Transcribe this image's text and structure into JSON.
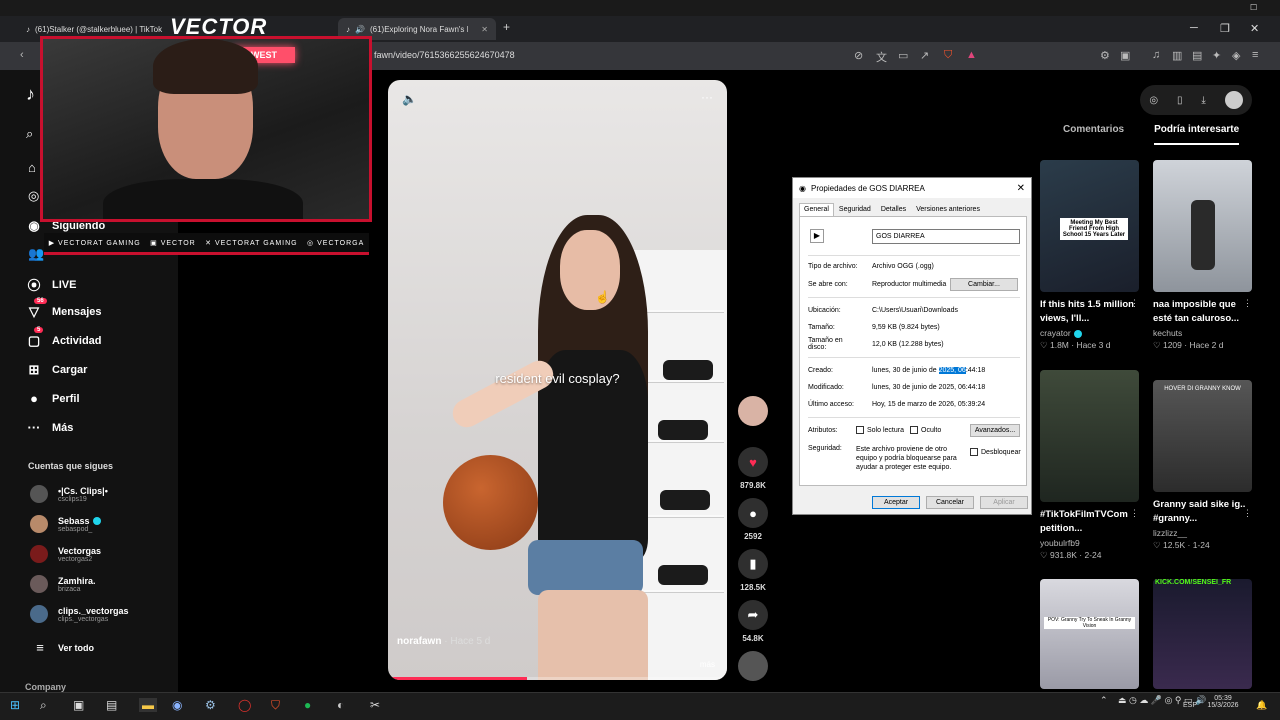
{
  "browser": {
    "tabs": [
      {
        "label": "(61)Stalker (@stalkerbluee) | TikTok",
        "active": false
      },
      {
        "label": "(61)Exploring Nora Fawn's Im...",
        "active": true
      }
    ],
    "new_tab": "+",
    "url": "fawn/video/7615366255624670478"
  },
  "stream": {
    "logo": "VECTOR",
    "cam_sign": "WEST",
    "socials": [
      "VECTORAT GAMING",
      "VECTOR",
      "VECTORAT GAMING",
      "VECTORGA"
    ]
  },
  "sidebar": {
    "following": "Siguiendo",
    "live": "LIVE",
    "messages": "Mensajes",
    "messages_badge": "56",
    "activity": "Actividad",
    "activity_badge": "5",
    "upload": "Cargar",
    "profile": "Perfil",
    "more": "Más",
    "accounts_label": "Cuentas que sigues",
    "accounts": [
      {
        "name": "•|Cs. Clips|•",
        "handle": "csclips19",
        "verified": false
      },
      {
        "name": "Sebass",
        "handle": "sebaspod_",
        "verified": true
      },
      {
        "name": "Vectorgas",
        "handle": "vectorgas2",
        "verified": false
      },
      {
        "name": "Zamhira.",
        "handle": "brizaca",
        "verified": false
      },
      {
        "name": "clips._vectorgas",
        "handle": "clips._vectorgas",
        "verified": false
      }
    ],
    "see_all": "Ver todo",
    "company": "Company"
  },
  "video": {
    "overlay_text": "resident evil cosplay?",
    "author": "norafawn",
    "time": "· Hace 5 d",
    "more": "más",
    "progress": 0.41
  },
  "actions": {
    "likes": "879.8K",
    "comments": "2592",
    "saves": "128.5K",
    "shares": "54.8K"
  },
  "dialog": {
    "title": "Propiedades de GOS DIARREA",
    "tabs": [
      "General",
      "Seguridad",
      "Detalles",
      "Versiones anteriores"
    ],
    "filename": "GOS DIARREA",
    "type_label": "Tipo de archivo:",
    "type_value": "Archivo OGG (.ogg)",
    "opens_label": "Se abre con:",
    "opens_value": "Reproductor multimedia",
    "change_btn": "Cambiar...",
    "location_label": "Ubicación:",
    "location_value": "C:\\Users\\Usuari\\Downloads",
    "size_label": "Tamaño:",
    "size_value": "9,59 KB (9.824 bytes)",
    "disk_label": "Tamaño en disco:",
    "disk_value": "12,0 KB (12.288 bytes)",
    "created_label": "Creado:",
    "created_prefix": "lunes, 30 de junio de ",
    "created_sel": "2025, 06",
    "created_suffix": ":44:18",
    "modified_label": "Modificado:",
    "modified_value": "lunes, 30 de junio de 2025, 06:44:18",
    "access_label": "Último acceso:",
    "access_value": "Hoy, 15 de marzo de 2026, 05:39:24",
    "attr_label": "Atributos:",
    "readonly": "Solo lectura",
    "hidden": "Oculto",
    "advanced_btn": "Avanzados...",
    "security_label": "Seguridad:",
    "security_text": "Este archivo proviene de otro equipo y podría bloquearse para ayudar a proteger este equipo.",
    "unblock": "Desbloquear",
    "ok": "Aceptar",
    "cancel": "Cancelar",
    "apply": "Aplicar"
  },
  "right_panel": {
    "tab_comments": "Comentarios",
    "tab_suggested": "Podría interesarte",
    "cards": [
      {
        "title": "If this hits 1.5 million views, I'll...",
        "user": "crayator",
        "verified": true,
        "stat": "♡ 1.8M · Hace 3 d",
        "thumb_text": "Meeting My Best Friend From High School 15 Years Later"
      },
      {
        "title": "naa imposible que esté tan caluroso...",
        "user": "kechuts",
        "verified": false,
        "stat": "♡ 1209 · Hace 2 d",
        "thumb_text": ""
      },
      {
        "title": "#TikTokFilmTVCom petition...",
        "user": "youbulrfb9",
        "verified": false,
        "stat": "♡ 931.8K · 2-24",
        "thumb_text": ""
      },
      {
        "title": "Granny said sike ig.. #granny...",
        "user": "lizzlizz__",
        "verified": false,
        "stat": "♡ 12.5K · 1-24",
        "thumb_text": "HOVER DI GRANNY KNOW"
      },
      {
        "title": "",
        "user": "",
        "verified": false,
        "stat": "",
        "thumb_text": "POV: Granny Try To Sneak In Granny Vision"
      },
      {
        "title": "",
        "user": "",
        "verified": false,
        "stat": "",
        "thumb_text": "KICK.COM/SENSEI_FR"
      }
    ]
  },
  "taskbar": {
    "lang": "ESP",
    "time": "05:39",
    "date": "15/3/2026"
  }
}
